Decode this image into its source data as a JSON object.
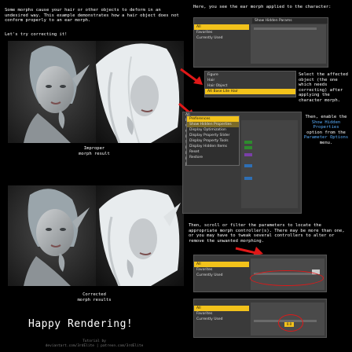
{
  "intro": {
    "paragraph": "Some morphs cause your hair or other objects to deform in an undesired way. This example demonstrates how a hair object does not conform properly to an ear morph.",
    "lets_try": "Let's try correcting it!"
  },
  "captions": {
    "improper_1": "Improper",
    "improper_2": "morph result",
    "corrected_1": "Corrected",
    "corrected_2": "morph results"
  },
  "right_notes": {
    "ear_morph": "Here, you see the ear morph applied to the character:",
    "select_object": "Select the affected object (the one which needs correcting) after applying the character morph.",
    "enable_hidden_1": "Then, enable the",
    "enable_hidden_2": "Show Hidden Properties",
    "enable_hidden_3": "option from the",
    "enable_hidden_4": "Parameter Options",
    "enable_hidden_5": "menu.",
    "scroll": "Then, scroll or filter the parameters to locate the appropriate morph controller(s). There may be more than one, or you may have to tweak several controllers to alter or remove the unwanted morphing."
  },
  "panel1": {
    "rows": [
      "All",
      "Favorites",
      "Currently Used",
      "",
      "",
      ""
    ],
    "header": "Show Hidden Params"
  },
  "panel2": {
    "rows": [
      "Figure",
      "Hair",
      "Hair Object",
      "Alt Base Lite Hair"
    ]
  },
  "panel3": {
    "menu": [
      "Preferences",
      "Show Hidden Properties",
      "Display Optimization",
      "Display Property Slider",
      "Display Property Tools",
      "Display Hidden Items",
      "Reset",
      "Restore"
    ],
    "side": [
      "All",
      "Favorites",
      "Currently Used",
      "General",
      "Display",
      "Shape",
      "Morphs",
      "Mesh",
      "Pose",
      "Joints"
    ]
  },
  "panel4": {
    "rows": [
      "All",
      "Favorites",
      "Currently Used"
    ]
  },
  "panel5": {
    "rows": [
      "All",
      "Favorites",
      "Currently Used"
    ],
    "value": "0.0"
  },
  "closing": {
    "happy": "Happy Rendering!",
    "credit_1": "Tutorial by",
    "credit_2": "deviantart.com/3rdElite | patreon.com/3rdElite"
  },
  "colors": {
    "highlight": "#f2c21b",
    "panel_bg": "#3a3a3a",
    "annotation": "#e01818"
  }
}
